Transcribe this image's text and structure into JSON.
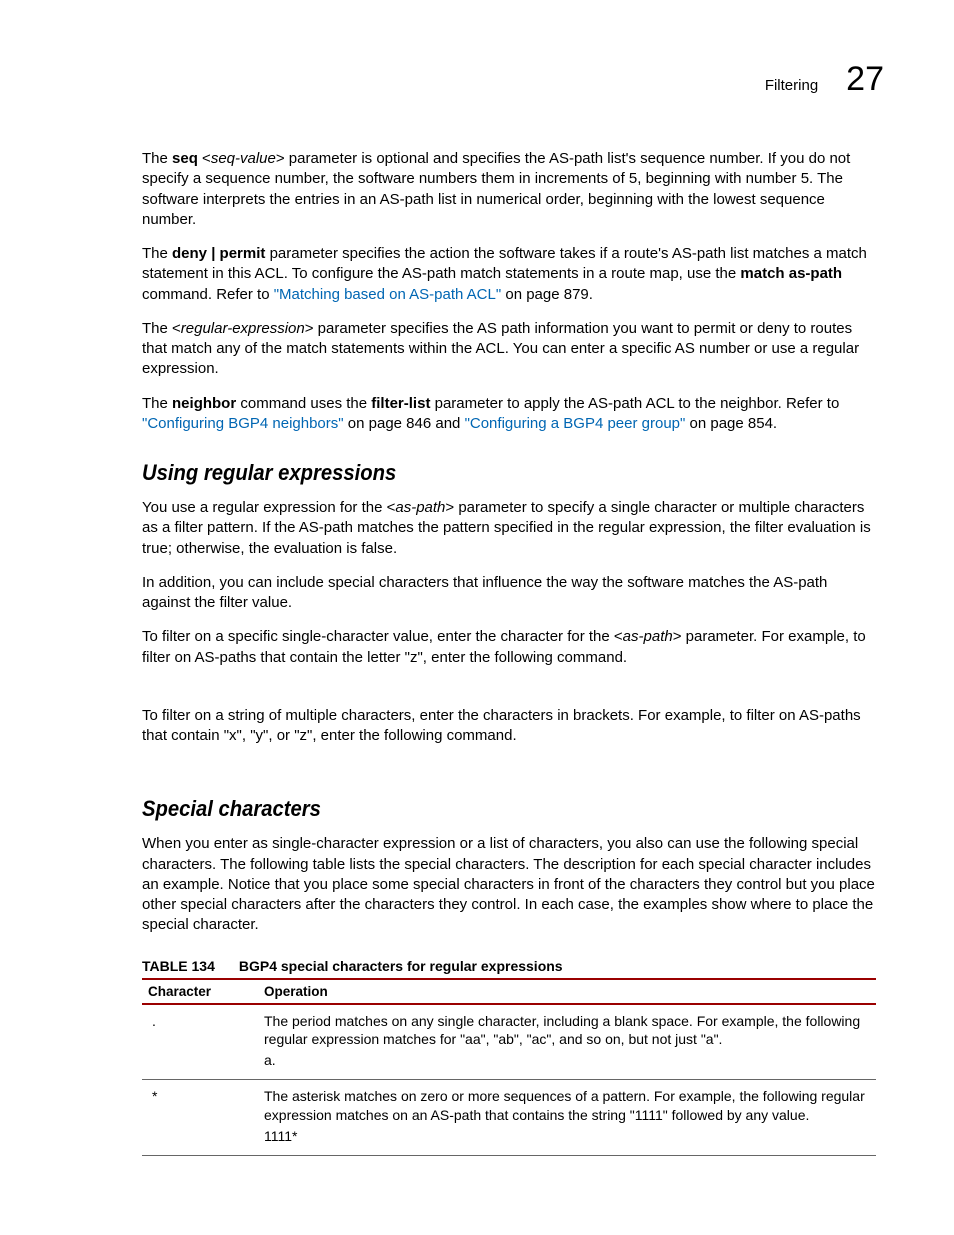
{
  "header": {
    "section": "Filtering",
    "chapter": "27"
  },
  "para1": {
    "pre": "The ",
    "b1": "seq",
    "mid1": " <",
    "i1": "seq-value",
    "post": "> parameter is optional and specifies the AS-path list's sequence number. If you do not specify a sequence number, the software numbers them in increments of 5, beginning with number 5.  The software interprets the entries in an AS-path list in numerical order, beginning with the lowest sequence number."
  },
  "para2": {
    "pre": "The ",
    "b1": "deny | permit",
    "mid": " parameter specifies the action the software takes if a route's AS-path list matches a match statement in this ACL. To configure the AS-path match statements in a route map, use the ",
    "b2": "match as-path",
    "mid2": " command. Refer to ",
    "link": "\"Matching based on AS-path ACL\"",
    "post": " on page 879."
  },
  "para3": {
    "pre": "The <",
    "i1": "regular-expression",
    "post": "> parameter specifies the AS path information you want to permit or deny to routes that match any of the match statements within the ACL.  You can enter a specific AS number or use a regular expression."
  },
  "para4": {
    "pre": "The ",
    "b1": "neighbor",
    "mid1": " command uses the ",
    "b2": "filter-list",
    "mid2": " parameter to apply the AS-path ACL to the neighbor.  Refer to ",
    "link1": "\"Configuring BGP4 neighbors\"",
    "mid3": " on page 846 and ",
    "link2": "\"Configuring a BGP4 peer group\"",
    "post": " on page 854."
  },
  "h_regex": "Using regular expressions",
  "para5": {
    "pre": "You use a regular expression for the <",
    "i1": "as-path",
    "post": "> parameter to specify a single character or multiple characters as a filter pattern.  If the AS-path matches the pattern specified in the regular expression, the filter evaluation is true; otherwise, the evaluation is false."
  },
  "para6": "In addition, you can include special characters that influence the way the software matches the AS-path against the filter value.",
  "para7": {
    "pre": "To filter on a specific single-character value, enter the character for the <",
    "i1": "as-path",
    "post": "> parameter.  For example, to filter on AS-paths that contain the letter \"z\", enter the following command."
  },
  "para8": "To filter on a string of multiple characters, enter the characters in brackets.  For example, to filter on AS-paths that contain \"x\", \"y\", or \"z\", enter the following command.",
  "h_special": "Special characters",
  "para9": "When you enter as single-character expression or a list of characters, you also can use the following special characters.  The following table lists the special characters.  The description for each special character includes an example.  Notice that you place some special characters in front of the characters they control but you place other special characters after the characters they control.  In each case, the examples show where to place the special character.",
  "table": {
    "label": "TABLE 134",
    "title": "BGP4 special characters for regular expressions",
    "head_char": "Character",
    "head_op": "Operation",
    "rows": [
      {
        "char": ".",
        "op": "The period matches on any single character, including a blank space.  For example, the following regular expression matches for \"aa\", \"ab\", \"ac\", and so on, but not just \"a\".",
        "ex": "a."
      },
      {
        "char": "*",
        "op": "The asterisk matches on zero or more sequences of a pattern.  For example, the following regular expression matches on an AS-path that contains the string \"1111\" followed by any value.",
        "ex": "1111*"
      }
    ]
  }
}
